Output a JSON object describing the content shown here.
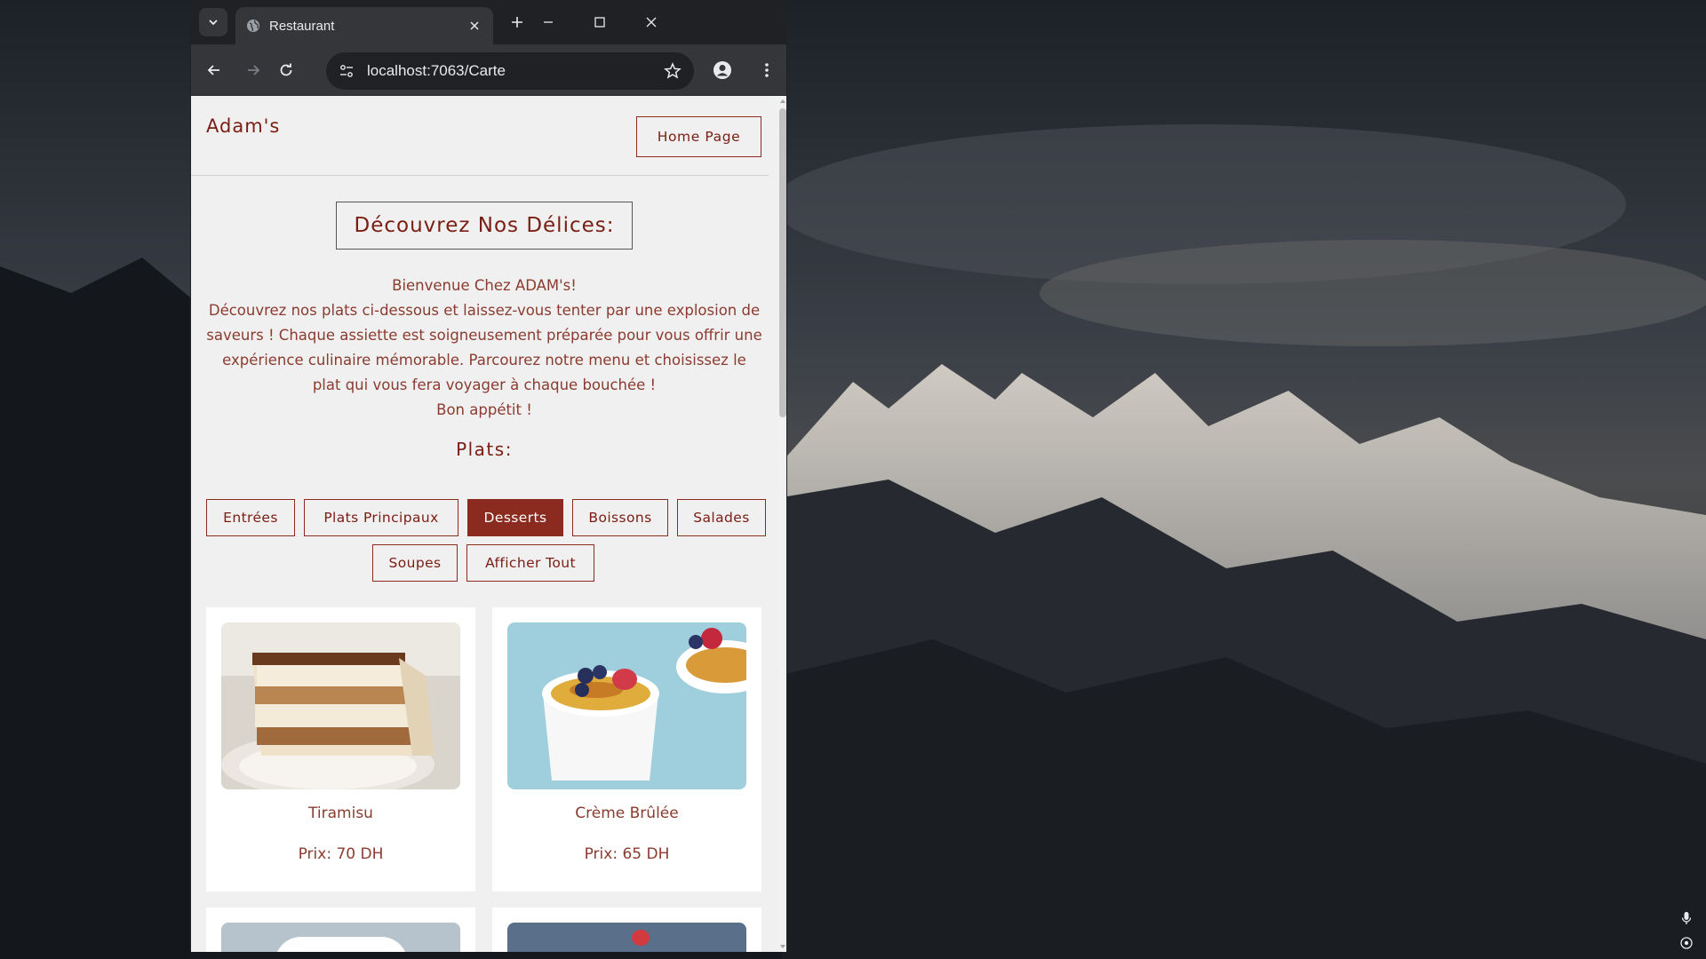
{
  "browser": {
    "tab_title": "Restaurant",
    "url": "localhost:7063/Carte"
  },
  "site": {
    "brand": "Adam's",
    "home_button": "Home Page",
    "hero_title": "Découvrez Nos Délices:",
    "intro_lines": [
      "Bienvenue Chez ADAM's!",
      "Découvrez nos plats ci-dessous et laissez-vous tenter par une explosion de",
      "saveurs ! Chaque assiette est soigneusement préparée pour vous offrir une",
      "expérience culinaire mémorable. Parcourez notre menu et choisissez le",
      "plat qui vous fera voyager à chaque bouchée !",
      "Bon appétit !"
    ],
    "plats_title": "Plats:",
    "filters": [
      {
        "label": "Entrées",
        "active": false
      },
      {
        "label": "Plats Principaux",
        "active": false
      },
      {
        "label": "Desserts",
        "active": true
      },
      {
        "label": "Boissons",
        "active": false
      },
      {
        "label": "Salades",
        "active": false
      },
      {
        "label": "Soupes",
        "active": false
      },
      {
        "label": "Afficher Tout",
        "active": false
      }
    ],
    "dishes": [
      {
        "name": "Tiramisu",
        "price": "Prix: 70 DH"
      },
      {
        "name": "Crème Brûlée",
        "price": "Prix: 65 DH"
      }
    ]
  },
  "colors": {
    "accent": "#8b2a1f",
    "text": "#7a1d12",
    "page_bg": "#f0f0f0"
  }
}
